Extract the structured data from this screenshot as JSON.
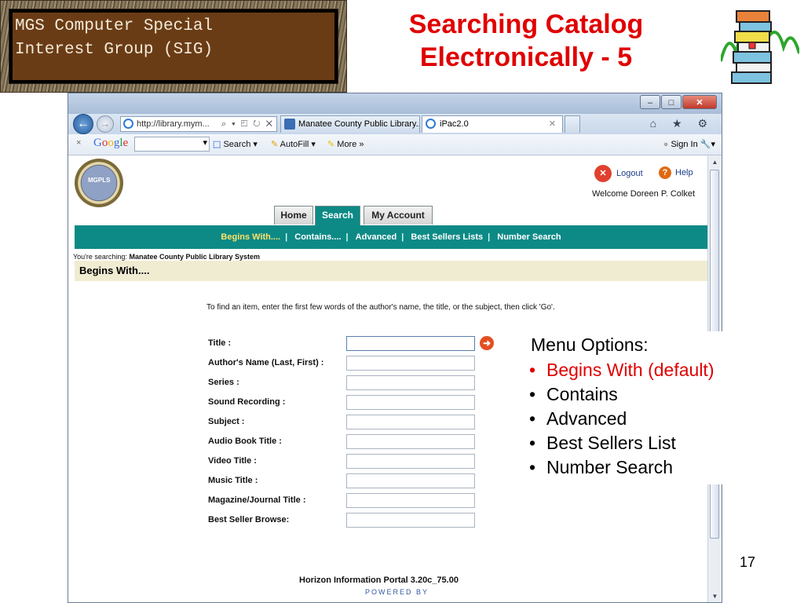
{
  "slide": {
    "group_label": "MGS Computer Special\nInterest Group (SIG)",
    "title": "Searching Catalog\nElectronically - 5",
    "page_number": "17"
  },
  "browser": {
    "address": "http://library.mym...",
    "address_controls": "⌕ ▾ ◰ ↻ ✕",
    "tabs": [
      {
        "label": "Manatee County Public Library...",
        "active": false
      },
      {
        "label": "iPac2.0",
        "active": true
      }
    ],
    "window_buttons": [
      "–",
      "□",
      "✕"
    ],
    "toolbar_icons": "⌂ ★ ⚙",
    "google_bar": {
      "close": "×",
      "logo": "Google",
      "search_label": "Search ▾",
      "autofill_label": "AutoFill ▾",
      "more_label": "More »",
      "signin_label": "Sign In"
    }
  },
  "page": {
    "logo_text": "MGPLS",
    "logout_label": "Logout",
    "help_label": "Help",
    "welcome_text": "Welcome Doreen P. Colket",
    "tabs": [
      "Home",
      "Search",
      "My Account"
    ],
    "active_tab": "Search",
    "submenu": [
      "Begins With....",
      "Contains....",
      "Advanced",
      "Best Sellers Lists",
      "Number Search"
    ],
    "searching_prefix": "You're searching:",
    "searching_library": "Manatee County Public Library System",
    "section_title": "Begins With....",
    "instructions": "To find an item, enter the first few words of the author's name, the title, or the subject, then click 'Go'.",
    "fields": [
      {
        "label": "Title :",
        "value": ""
      },
      {
        "label": "Author's Name (Last, First) :",
        "value": ""
      },
      {
        "label": "Series :",
        "value": ""
      },
      {
        "label": "Sound Recording :",
        "value": ""
      },
      {
        "label": "Subject :",
        "value": ""
      },
      {
        "label": "Audio Book Title :",
        "value": ""
      },
      {
        "label": "Video Title :",
        "value": ""
      },
      {
        "label": "Music Title :",
        "value": ""
      },
      {
        "label": "Magazine/Journal Title :",
        "value": ""
      },
      {
        "label": "Best Seller Browse:",
        "value": ""
      }
    ],
    "footer_version": "Horizon Information Portal 3.20c_75.00",
    "footer_powered": "Powered by"
  },
  "callout": {
    "title": "Menu Options:",
    "items": [
      {
        "text": "Begins With (default)",
        "highlight": true
      },
      {
        "text": "Contains",
        "highlight": false
      },
      {
        "text": "Advanced",
        "highlight": false
      },
      {
        "text": "Best Sellers List",
        "highlight": false
      },
      {
        "text": "Number Search",
        "highlight": false
      }
    ]
  },
  "colors": {
    "title_red": "#e00000",
    "teal_bar": "#0d8a86",
    "begins_band": "#f0ecd2",
    "current_submenu": "#ffe26a"
  }
}
